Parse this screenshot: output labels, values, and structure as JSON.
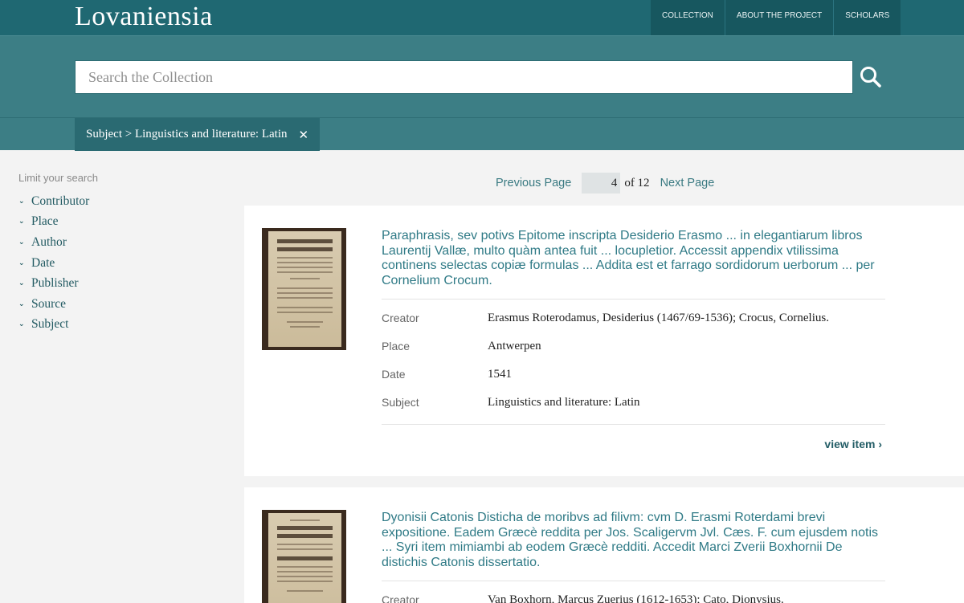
{
  "header": {
    "logo": "Lovaniensia",
    "nav": [
      "COLLECTION",
      "ABOUT THE PROJECT",
      "SCHOLARS"
    ]
  },
  "search": {
    "placeholder": "Search the Collection",
    "button_icon": "search-icon"
  },
  "filter": {
    "label": "Subject > Linguistics and literature: Latin",
    "remove_icon": "close-icon"
  },
  "sidebar": {
    "title": "Limit your search",
    "facets": [
      "Contributor",
      "Place",
      "Author",
      "Date",
      "Publisher",
      "Source",
      "Subject"
    ]
  },
  "pager": {
    "prev": "Previous Page",
    "current": "4",
    "of": "of 12",
    "next": "Next Page"
  },
  "results": [
    {
      "title": "Paraphrasis, sev potivs Epitome inscripta Desiderio Erasmo ... in elegantiarum libros Laurentij Vallæ, multo quàm antea fuit ... locupletior. Accessit appendix vtilissima continens selectas copiæ formulas ... Addita est et farrago sordidorum uerborum ... per Cornelium Crocum.",
      "fields": [
        {
          "label": "Creator",
          "value": "Erasmus Roterodamus, Desiderius (1467/69-1536); Crocus, Cornelius."
        },
        {
          "label": "Place",
          "value": "Antwerpen"
        },
        {
          "label": "Date",
          "value": "1541"
        },
        {
          "label": "Subject",
          "value": "Linguistics and literature: Latin"
        }
      ],
      "view": "view item ›"
    },
    {
      "title": "Dyonisii Catonis Disticha de moribvs ad filivm: cvm D. Erasmi Roterdami brevi expositione. Eadem Græcè reddita per Jos. Scaligervm Jvl. Cæs. F. cum ejusdem notis ... Syri item mimiambi ab eodem Græcè redditi. Accedit Marci Zverii Boxhornii De distichis Catonis dissertatio.",
      "fields": [
        {
          "label": "Creator",
          "value": "Van Boxhorn, Marcus Zuerius (1612-1653); Cato, Dionysius."
        }
      ]
    }
  ]
}
